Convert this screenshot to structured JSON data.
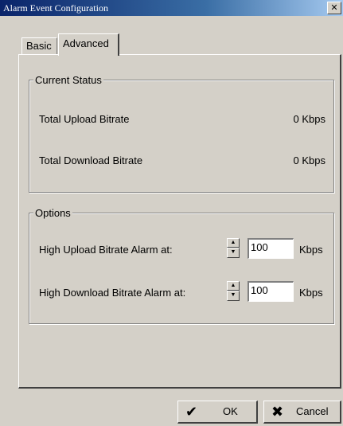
{
  "window": {
    "title": "Alarm Event Configuration",
    "close_glyph": "✕"
  },
  "tabs": [
    {
      "label": "Basic",
      "selected": false
    },
    {
      "label": "Advanced",
      "selected": true
    }
  ],
  "current_status": {
    "legend": "Current Status",
    "rows": [
      {
        "label": "Total Upload Bitrate",
        "value": "0 Kbps"
      },
      {
        "label": "Total Download Bitrate",
        "value": "0 Kbps"
      }
    ]
  },
  "options": {
    "legend": "Options",
    "rows": [
      {
        "label": "High Upload Bitrate Alarm at:",
        "value": "100",
        "unit": "Kbps"
      },
      {
        "label": "High Download Bitrate Alarm at:",
        "value": "100",
        "unit": "Kbps"
      }
    ]
  },
  "buttons": {
    "ok_label": "OK",
    "ok_icon": "✔",
    "cancel_label": "Cancel",
    "cancel_icon": "✖"
  },
  "icons": {
    "spin_up": "▲",
    "spin_down": "▼"
  }
}
